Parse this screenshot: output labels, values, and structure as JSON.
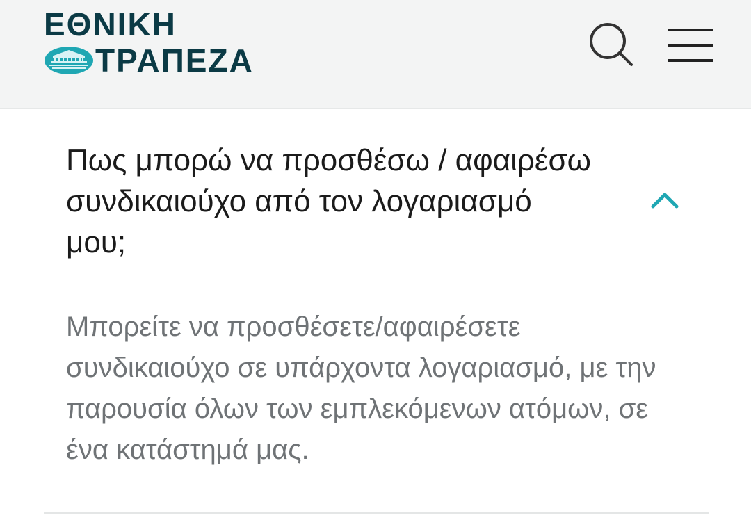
{
  "header": {
    "logo": {
      "line1": "ΕΘΝΙΚΗ",
      "line2": "ΤΡΑΠΕΖΑ",
      "emblem_icon": "bank-building-emblem-icon"
    },
    "search_icon": "search-icon",
    "menu_icon": "hamburger-menu-icon"
  },
  "faq": {
    "question": "Πως μπορώ να προσθέσω / αφαιρέσω συνδικαιούχο από τον λογαριασμό μου;",
    "answer": "Μπορείτε να προσθέσετε/αφαιρέσετε συνδικαιούχο σε υπάρχοντα λογαριασμό, με την παρουσία όλων των εμπλεκόμενων ατόμων, σε ένα κατάστημά μας.",
    "expanded": true,
    "toggle_icon": "chevron-up-icon"
  },
  "colors": {
    "brand_dark": "#0b3a45",
    "brand_teal": "#1fa7b3",
    "header_bg": "#f3f4f4",
    "question_text": "#1b1b1b",
    "answer_text": "#6f7376"
  }
}
